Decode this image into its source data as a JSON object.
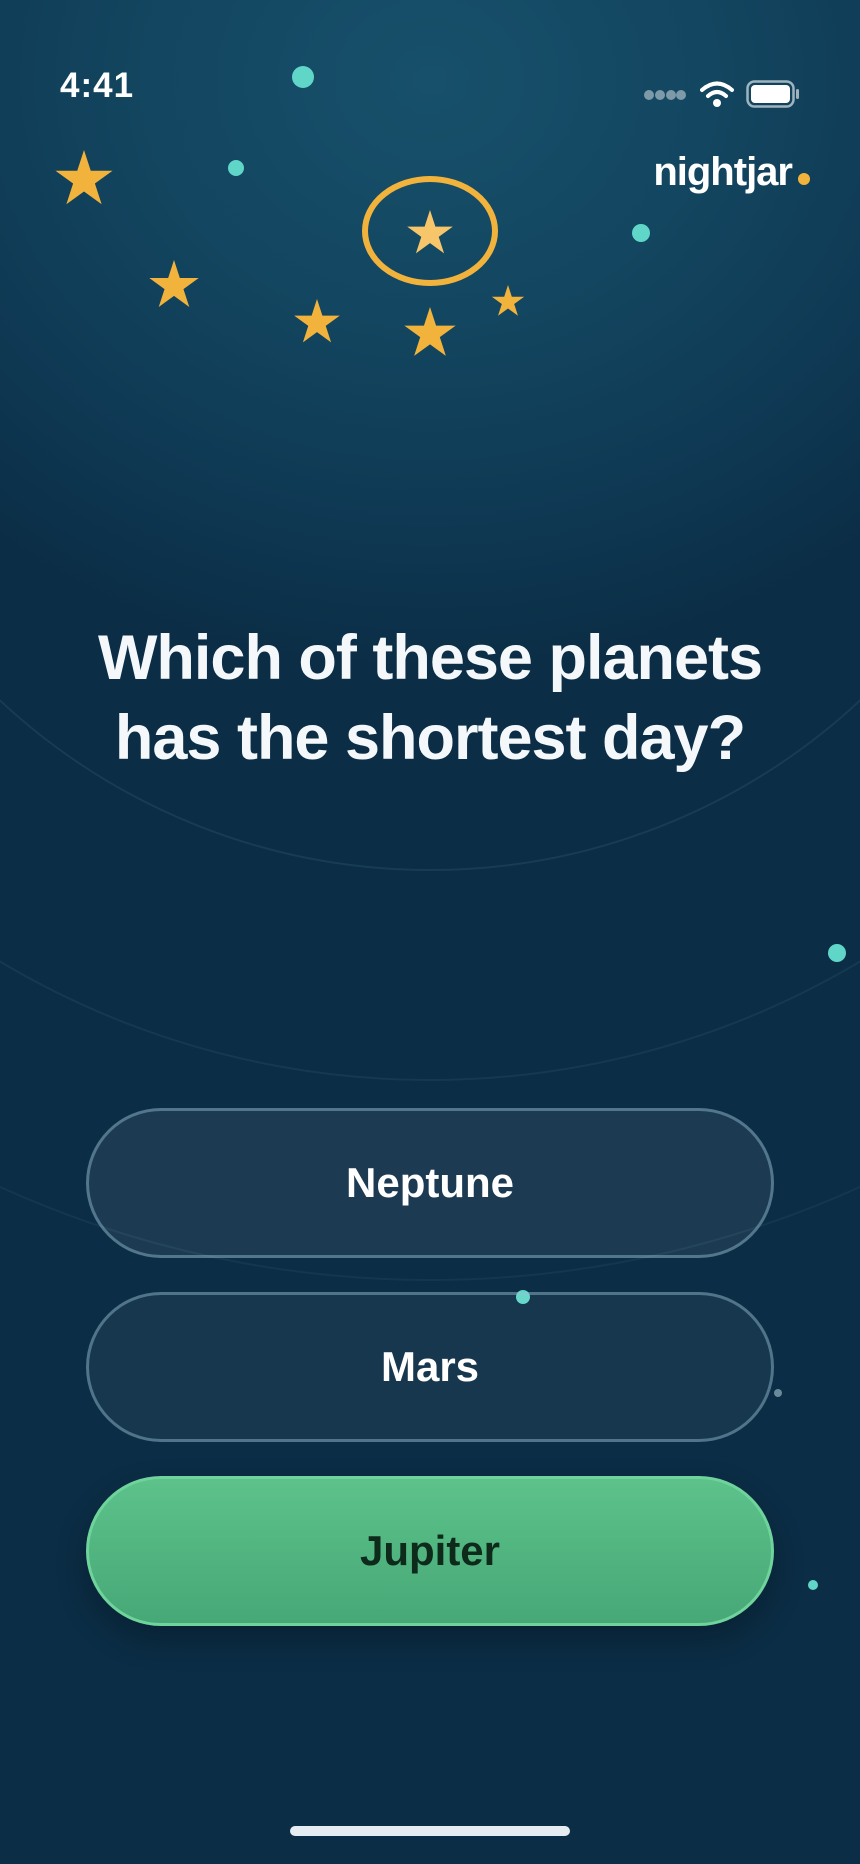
{
  "status_bar": {
    "time": "4:41"
  },
  "brand": {
    "name": "nightjar",
    "accent_color": "#f2b33d"
  },
  "quiz": {
    "question": "Which of these planets has the shortest day?",
    "answers": [
      {
        "label": "Neptune",
        "selected": false
      },
      {
        "label": "Mars",
        "selected": false
      },
      {
        "label": "Jupiter",
        "selected": true
      }
    ]
  },
  "colors": {
    "background": "#134660",
    "star": "#f2b33d",
    "dot_accent": "#5fd6c8",
    "answer_selected": "#52b882"
  },
  "icons": [
    "signal-icon",
    "wifi-icon",
    "battery-icon",
    "star-icon"
  ]
}
